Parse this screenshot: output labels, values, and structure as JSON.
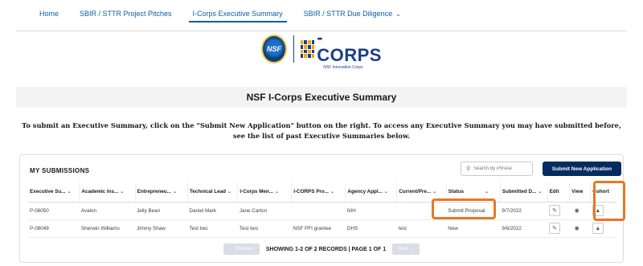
{
  "nav": {
    "items": [
      {
        "label": "Home"
      },
      {
        "label": "SBIR / STTR Project Pitches"
      },
      {
        "label": "I-Corps Executive Summary",
        "active": true
      },
      {
        "label": "SBIR / STTR Due Diligence",
        "dropdown": true
      }
    ]
  },
  "logo": {
    "seal_text": "NSF",
    "name": "CORPS",
    "prefix": "I",
    "tagline": "NSF Innovation Corps"
  },
  "page": {
    "title": "NSF I-Corps Executive Summary",
    "instructions": "To submit an Executive Summary, click on the \"Submit New Application\" button on the right. To access any Executive Summary you may have submitted before, see the list of past Executive Summaries below."
  },
  "submissions": {
    "header": "MY SUBMISSIONS",
    "search_placeholder": "Search by Phrase",
    "new_button": "Submit New Application",
    "columns": [
      "Executive Su...",
      "Academic Ins...",
      "Entrepreneu...",
      "Technical Lead",
      "I-Corps Men...",
      "I-CORPS Pro...",
      "Agency Appl...",
      "Current/Pre...",
      "Status",
      "Submitted D...",
      "Edit",
      "View",
      "Cohort"
    ],
    "rows": [
      [
        "P-08050",
        "Avalon",
        "Jelly Bean",
        "Daniel Mark",
        "Jane Carton",
        "",
        "NIH",
        "",
        "Submit Proposal",
        "9/7/2022"
      ],
      [
        "P-08049",
        "Sherwin Williams",
        "Jimmy Shaw",
        "Test two",
        "Test two",
        "NSF PFI grantee",
        "DHS",
        "test",
        "New",
        "9/6/2022"
      ]
    ],
    "pager": {
      "prev": "← Previous",
      "next": "Next →",
      "summary": "SHOWING 1-2 OF 2 RECORDS | PAGE 1 OF 1"
    }
  },
  "colors": {
    "accent": "#0b5cab",
    "primary_button": "#032d60",
    "highlight": "#e87722"
  }
}
